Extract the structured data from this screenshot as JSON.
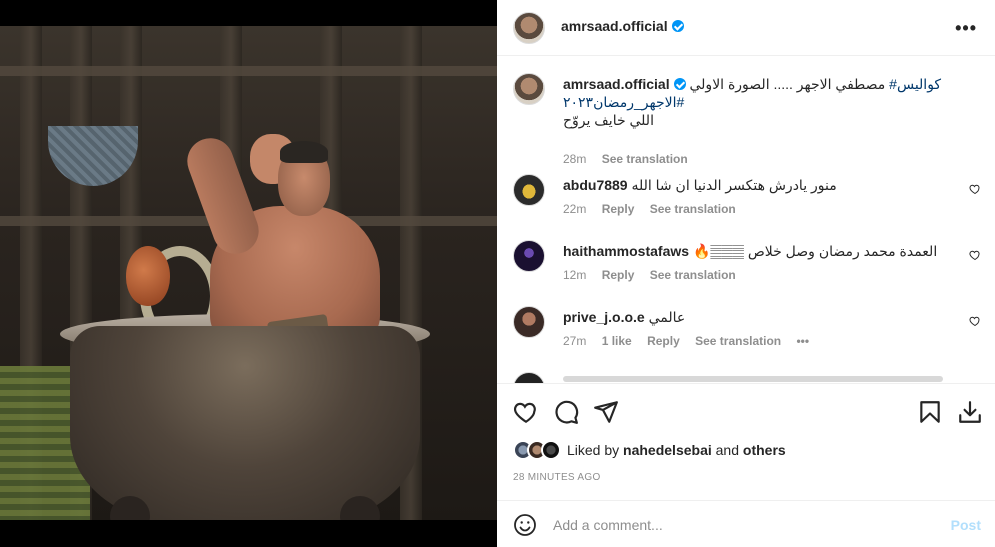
{
  "post": {
    "username": "amrsaad.official",
    "verified_icon": "verified-badge-icon",
    "more_label": "•••",
    "photo_alt": "Actor sitting in a vintage bathtub inside a wooden shack, saluting"
  },
  "caption": {
    "username": "amrsaad.official",
    "line1": "مصطفي الاجهر ..... الصورة الاولي",
    "hashtag1": "#كواليس",
    "hashtag2": "#الاجهر_رمضان٢٠٢٣",
    "line3": "اللي خايف يروّح",
    "time": "28m",
    "see_translation": "See translation"
  },
  "comments": [
    {
      "username": "abdu7889",
      "text": "منور يادرش هتكسر الدنيا ان شا الله",
      "time": "22m",
      "reply": "Reply",
      "see_translation": "See translation",
      "likes": ""
    },
    {
      "username": "haithammostafaws",
      "text": "🔥𝄛𝄛𝄛 العمدة محمد رمضان وصل خلاص",
      "time": "12m",
      "reply": "Reply",
      "see_translation": "See translation",
      "likes": ""
    },
    {
      "username": "prive_j.o.o.e",
      "text": "عالمي",
      "time": "27m",
      "likes": "1 like",
      "reply": "Reply",
      "see_translation": "See translation",
      "more": "•••"
    }
  ],
  "likes": {
    "prefix": "Liked by",
    "user": "nahedelsebai",
    "and": "and",
    "others": "others"
  },
  "timestamp": "28 MINUTES AGO",
  "add_comment": {
    "placeholder": "Add a comment...",
    "post_label": "Post"
  },
  "colors": {
    "link": "#00376b",
    "verified": "#0095f6",
    "muted": "#8e8e8e",
    "post_disabled": "#b2dffc"
  }
}
